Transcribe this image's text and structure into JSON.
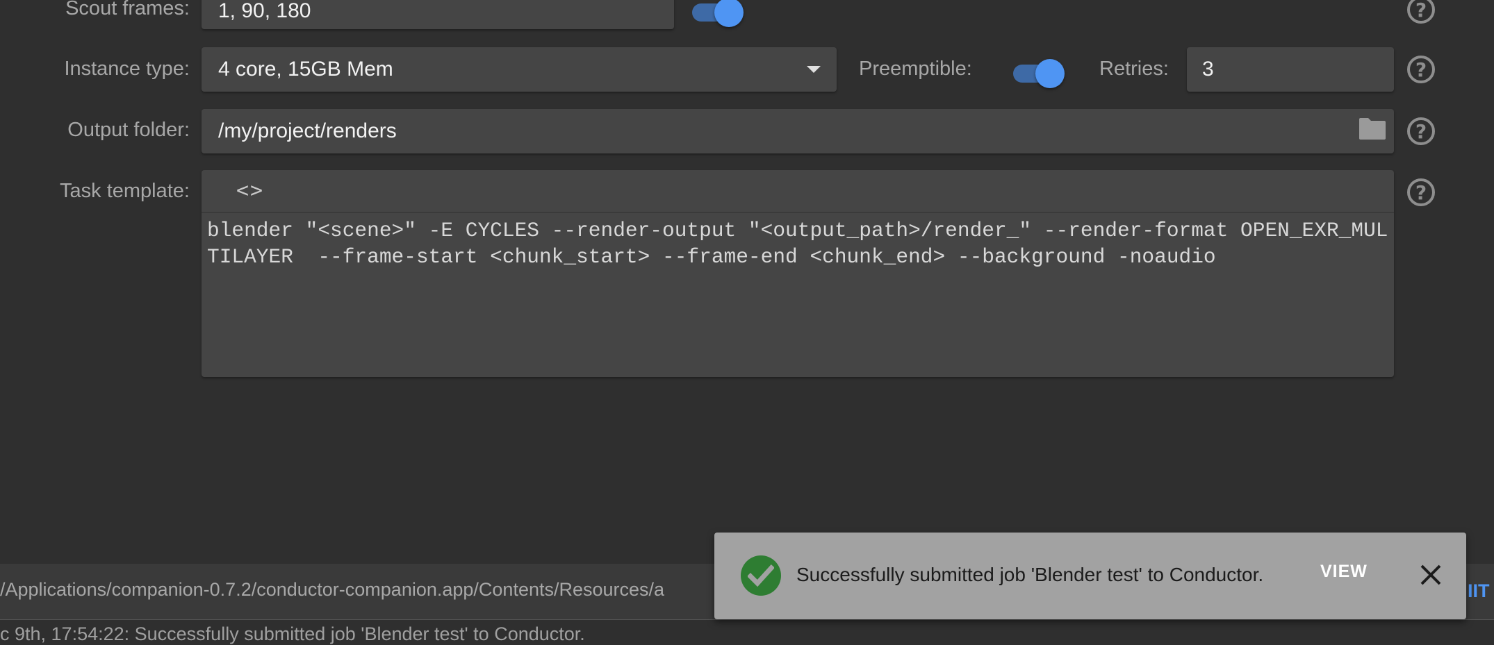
{
  "form": {
    "scout_frames": {
      "label": "Scout frames:",
      "value": "1, 90, 180",
      "toggle_on": true
    },
    "instance_type": {
      "label": "Instance type:",
      "value": "4 core, 15GB Mem"
    },
    "preemptible": {
      "label": "Preemptible:",
      "toggle_on": true
    },
    "retries": {
      "label": "Retries:",
      "value": "3"
    },
    "output_folder": {
      "label": "Output folder:",
      "value": "/my/project/renders"
    },
    "task_template": {
      "label": "Task template:",
      "toolbar_icon": "<>",
      "value": "blender \"<scene>\" -E CYCLES --render-output \"<output_path>/render_\" --render-format OPEN_EXR_MULTILAYER  --frame-start <chunk_start> --frame-end <chunk_end> --background -noaudio"
    },
    "help_glyph": "?"
  },
  "status_bar": {
    "path": "/Applications/companion-0.7.2/conductor-companion.app/Contents/Resources/a",
    "submit_fragment": "IIT"
  },
  "log": {
    "line": "c 9th, 17:54:22: Successfully submitted job 'Blender test' to Conductor."
  },
  "snackbar": {
    "message": "Successfully submitted job 'Blender test' to Conductor.",
    "view_label": "VIEW"
  },
  "colors": {
    "background": "#2f2f2f",
    "field": "#454545",
    "accent": "#4f95f3",
    "success": "#2e7d32",
    "snackbar": "#a2a2a2"
  },
  "icons": [
    "help-icon",
    "dropdown-arrow-icon",
    "folder-icon",
    "code-icon",
    "check-circle-icon",
    "close-icon"
  ]
}
